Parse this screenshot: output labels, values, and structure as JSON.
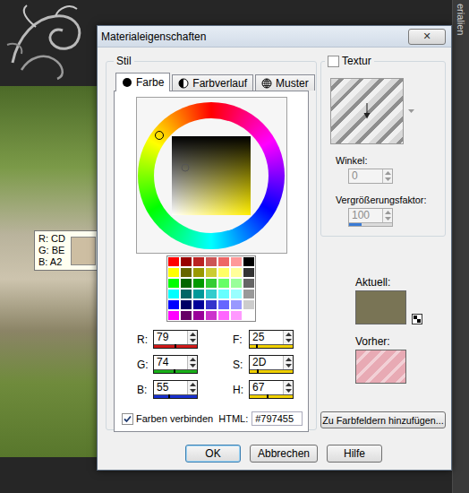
{
  "desktop": {
    "side_label": "erialien"
  },
  "tooltip": {
    "lines": [
      "R: CD",
      "G: BE",
      "B: A2"
    ],
    "color": "#CDBEA2"
  },
  "window": {
    "title": "Materialeigenschaften",
    "close": "✕"
  },
  "style_group": {
    "label": "Stil",
    "tabs": [
      {
        "label": "Farbe",
        "selected": true,
        "kind": "solid"
      },
      {
        "label": "Farbverlauf",
        "selected": false,
        "kind": "gradient"
      },
      {
        "label": "Muster",
        "selected": false,
        "kind": "pattern"
      }
    ],
    "wheel": {
      "hue": 0.145,
      "saturation": 0.176,
      "lightness": 0.404
    },
    "palette": [
      [
        "#ff0000",
        "#990000",
        "#bb2222",
        "#cc5555",
        "#ee6666",
        "#ff9999",
        "#000000"
      ],
      [
        "#ffff00",
        "#666600",
        "#999900",
        "#cccc33",
        "#ffff66",
        "#ffff99",
        "#333333"
      ],
      [
        "#00ff00",
        "#006600",
        "#009900",
        "#33cc33",
        "#66ff66",
        "#99ff99",
        "#666666"
      ],
      [
        "#00ffff",
        "#006666",
        "#009999",
        "#33cccc",
        "#66ffff",
        "#99ffff",
        "#999999"
      ],
      [
        "#0000ff",
        "#000066",
        "#000099",
        "#3333cc",
        "#6666ff",
        "#9999ff",
        "#cccccc"
      ],
      [
        "#ff00ff",
        "#660066",
        "#990099",
        "#cc33cc",
        "#ff66ff",
        "#ff99ff",
        "#ffffff"
      ]
    ],
    "rgb": [
      {
        "label": "R:",
        "value": "79",
        "level": 0.475,
        "color": "#d01818"
      },
      {
        "label": "G:",
        "value": "74",
        "level": 0.455,
        "color": "#18b018"
      },
      {
        "label": "B:",
        "value": "55",
        "level": 0.333,
        "color": "#1830d0"
      }
    ],
    "hsl": [
      {
        "label": "F:",
        "value": "25",
        "level": 0.145,
        "color": "#f0d000"
      },
      {
        "label": "S:",
        "value": "2D",
        "level": 0.176,
        "color": "#f0d000"
      },
      {
        "label": "H:",
        "value": "67",
        "level": 0.404,
        "color": "#f0d000"
      }
    ],
    "link_colors": {
      "label": "Farben verbinden",
      "checked": true
    },
    "html": {
      "label": "HTML:",
      "value": "#797455"
    }
  },
  "texture": {
    "label": "Textur",
    "checked": false,
    "angle": {
      "label": "Winkel:",
      "value": "0",
      "disabled": true
    },
    "scale": {
      "label": "Vergrößerungsfaktor:",
      "value": "100",
      "disabled": true,
      "level": 0.3,
      "color": "#3a7bd5"
    }
  },
  "current": {
    "label": "Aktuell:",
    "color": "#797455"
  },
  "previous": {
    "label": "Vorher:",
    "color": "#e8aab4"
  },
  "add_button": "Zu Farbfeldern hinzufügen...",
  "buttons": [
    {
      "label": "OK",
      "default": true
    },
    {
      "label": "Abbrechen",
      "default": false
    },
    {
      "label": "Hilfe",
      "default": false
    }
  ]
}
